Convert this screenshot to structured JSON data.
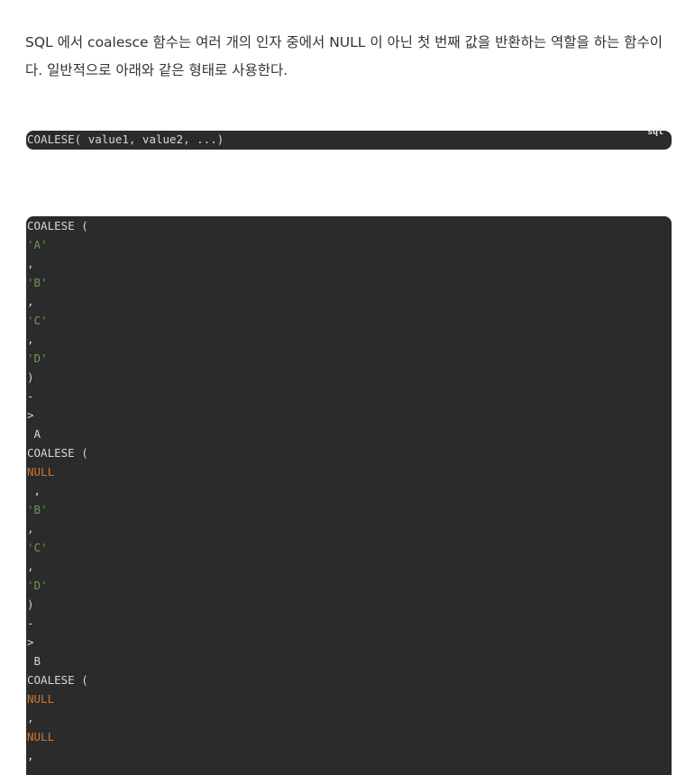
{
  "article": {
    "paragraph": "SQL 에서 coalesce 함수는 여러 개의 인자 중에서 NULL 이 아닌 첫 번째 값을 반환하는 역할을 하는 함수이다. 일반적으로 아래와 같은 형태로 사용한다."
  },
  "code_block_1": {
    "language": "sql",
    "code": "COALESE( value1, value2, ...)"
  },
  "code_block_2": {
    "tokens": [
      {
        "text": "COALESE (",
        "type": "plain"
      },
      {
        "text": "'A'",
        "type": "string"
      },
      {
        "text": ",",
        "type": "plain"
      },
      {
        "text": "'B'",
        "type": "string"
      },
      {
        "text": ",",
        "type": "plain"
      },
      {
        "text": "'C'",
        "type": "string"
      },
      {
        "text": ",",
        "type": "plain"
      },
      {
        "text": "'D'",
        "type": "string"
      },
      {
        "text": ")",
        "type": "plain"
      },
      {
        "text": "-",
        "type": "plain"
      },
      {
        "text": ">",
        "type": "plain"
      },
      {
        "text": " A",
        "type": "plain"
      },
      {
        "text": "COALESE (",
        "type": "plain"
      },
      {
        "text": "NULL",
        "type": "keyword"
      },
      {
        "text": " ,",
        "type": "plain"
      },
      {
        "text": "'B'",
        "type": "string"
      },
      {
        "text": ",",
        "type": "plain"
      },
      {
        "text": "'C'",
        "type": "string"
      },
      {
        "text": ",",
        "type": "plain"
      },
      {
        "text": "'D'",
        "type": "string"
      },
      {
        "text": ")",
        "type": "plain"
      },
      {
        "text": "-",
        "type": "plain"
      },
      {
        "text": ">",
        "type": "plain"
      },
      {
        "text": " B",
        "type": "plain"
      },
      {
        "text": "COALESE (",
        "type": "plain"
      },
      {
        "text": "NULL",
        "type": "keyword"
      },
      {
        "text": ",",
        "type": "plain"
      },
      {
        "text": "NULL",
        "type": "keyword"
      },
      {
        "text": ",",
        "type": "plain"
      }
    ]
  }
}
